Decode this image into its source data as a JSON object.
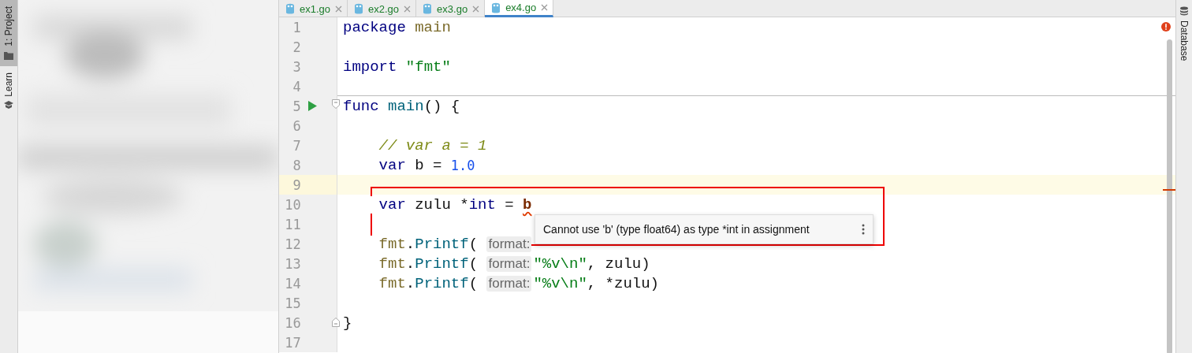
{
  "tool_strip_left": [
    {
      "label": "1: Project",
      "kind": "folder",
      "selected": true
    },
    {
      "label": "Learn",
      "kind": "learn",
      "selected": false
    }
  ],
  "tabs": [
    {
      "label": "ex1.go",
      "selected": false
    },
    {
      "label": "ex2.go",
      "selected": false
    },
    {
      "label": "ex3.go",
      "selected": false
    },
    {
      "label": "ex4.go",
      "selected": true
    }
  ],
  "lines": [
    {
      "number": "1",
      "kind": "code",
      "current": false,
      "separator": false,
      "tokens": [
        {
          "kind": "kw",
          "text": "package "
        },
        {
          "kind": "pkg",
          "text": "main"
        }
      ]
    },
    {
      "number": "2",
      "kind": "code",
      "current": false,
      "separator": false
    },
    {
      "number": "3",
      "kind": "code",
      "current": false,
      "separator": false,
      "tokens": [
        {
          "kind": "kw",
          "text": "import "
        },
        {
          "kind": "str",
          "text": "\"fmt\""
        }
      ]
    },
    {
      "number": "4",
      "kind": "code",
      "current": false,
      "separator": true
    },
    {
      "number": "5",
      "kind": "run-fold",
      "current": false,
      "separator": false,
      "tokens": [
        {
          "kind": "kw",
          "text": "func "
        },
        {
          "kind": "fn",
          "text": "main"
        },
        {
          "kind": "plain",
          "text": "() {"
        }
      ]
    },
    {
      "number": "6",
      "kind": "code",
      "current": false,
      "separator": false
    },
    {
      "number": "7",
      "kind": "code",
      "current": false,
      "separator": false,
      "tokens": [
        {
          "kind": "comment",
          "text": "    // var a = 1"
        }
      ]
    },
    {
      "number": "8",
      "kind": "code",
      "current": false,
      "separator": false,
      "tokens": [
        {
          "kind": "kw",
          "text": "    var "
        },
        {
          "kind": "plain",
          "text": "b = "
        },
        {
          "kind": "num",
          "text": "1.0"
        }
      ]
    },
    {
      "number": "9",
      "kind": "code",
      "current": true,
      "separator": false
    },
    {
      "number": "10",
      "kind": "code",
      "current": false,
      "separator": false,
      "tokens": [
        {
          "kind": "kw",
          "text": "    var "
        },
        {
          "kind": "plain",
          "text": "zulu *"
        },
        {
          "kind": "kw",
          "text": "int"
        },
        {
          "kind": "plain",
          "text": " = "
        },
        {
          "kind": "error",
          "text": "b"
        }
      ]
    },
    {
      "number": "11",
      "kind": "code",
      "current": false,
      "separator": false
    },
    {
      "number": "12",
      "kind": "code",
      "current": false,
      "separator": false,
      "tokens": [
        {
          "kind": "pkg",
          "text": "    fmt"
        },
        {
          "kind": "plain",
          "text": "."
        },
        {
          "kind": "fn",
          "text": "Printf"
        },
        {
          "kind": "plain",
          "text": "( "
        },
        {
          "kind": "hint",
          "text": "format:"
        }
      ]
    },
    {
      "number": "13",
      "kind": "code",
      "current": false,
      "separator": false,
      "tokens": [
        {
          "kind": "pkg",
          "text": "    fmt"
        },
        {
          "kind": "plain",
          "text": "."
        },
        {
          "kind": "fn",
          "text": "Printf"
        },
        {
          "kind": "plain",
          "text": "( "
        },
        {
          "kind": "hint",
          "text": "format:"
        },
        {
          "kind": "str",
          "text": "\"%v\\n\""
        },
        {
          "kind": "plain",
          "text": ", zulu)"
        }
      ]
    },
    {
      "number": "14",
      "kind": "code",
      "current": false,
      "separator": false,
      "tokens": [
        {
          "kind": "pkg",
          "text": "    fmt"
        },
        {
          "kind": "plain",
          "text": "."
        },
        {
          "kind": "fn",
          "text": "Printf"
        },
        {
          "kind": "plain",
          "text": "( "
        },
        {
          "kind": "hint",
          "text": "format:"
        },
        {
          "kind": "str",
          "text": "\"%v\\n\""
        },
        {
          "kind": "plain",
          "text": ", *zulu)"
        }
      ]
    },
    {
      "number": "15",
      "kind": "code",
      "current": false,
      "separator": false
    },
    {
      "number": "16",
      "kind": "fold-end",
      "current": false,
      "separator": false,
      "tokens": [
        {
          "kind": "plain",
          "text": "}"
        }
      ]
    },
    {
      "number": "17",
      "kind": "code",
      "current": false,
      "separator": false
    }
  ],
  "error_tooltip": {
    "message": "Cannot use 'b' (type float64) as type *int in assignment"
  },
  "tool_strip_right": [
    {
      "label": "Database",
      "kind": "database",
      "selected": false
    }
  ]
}
